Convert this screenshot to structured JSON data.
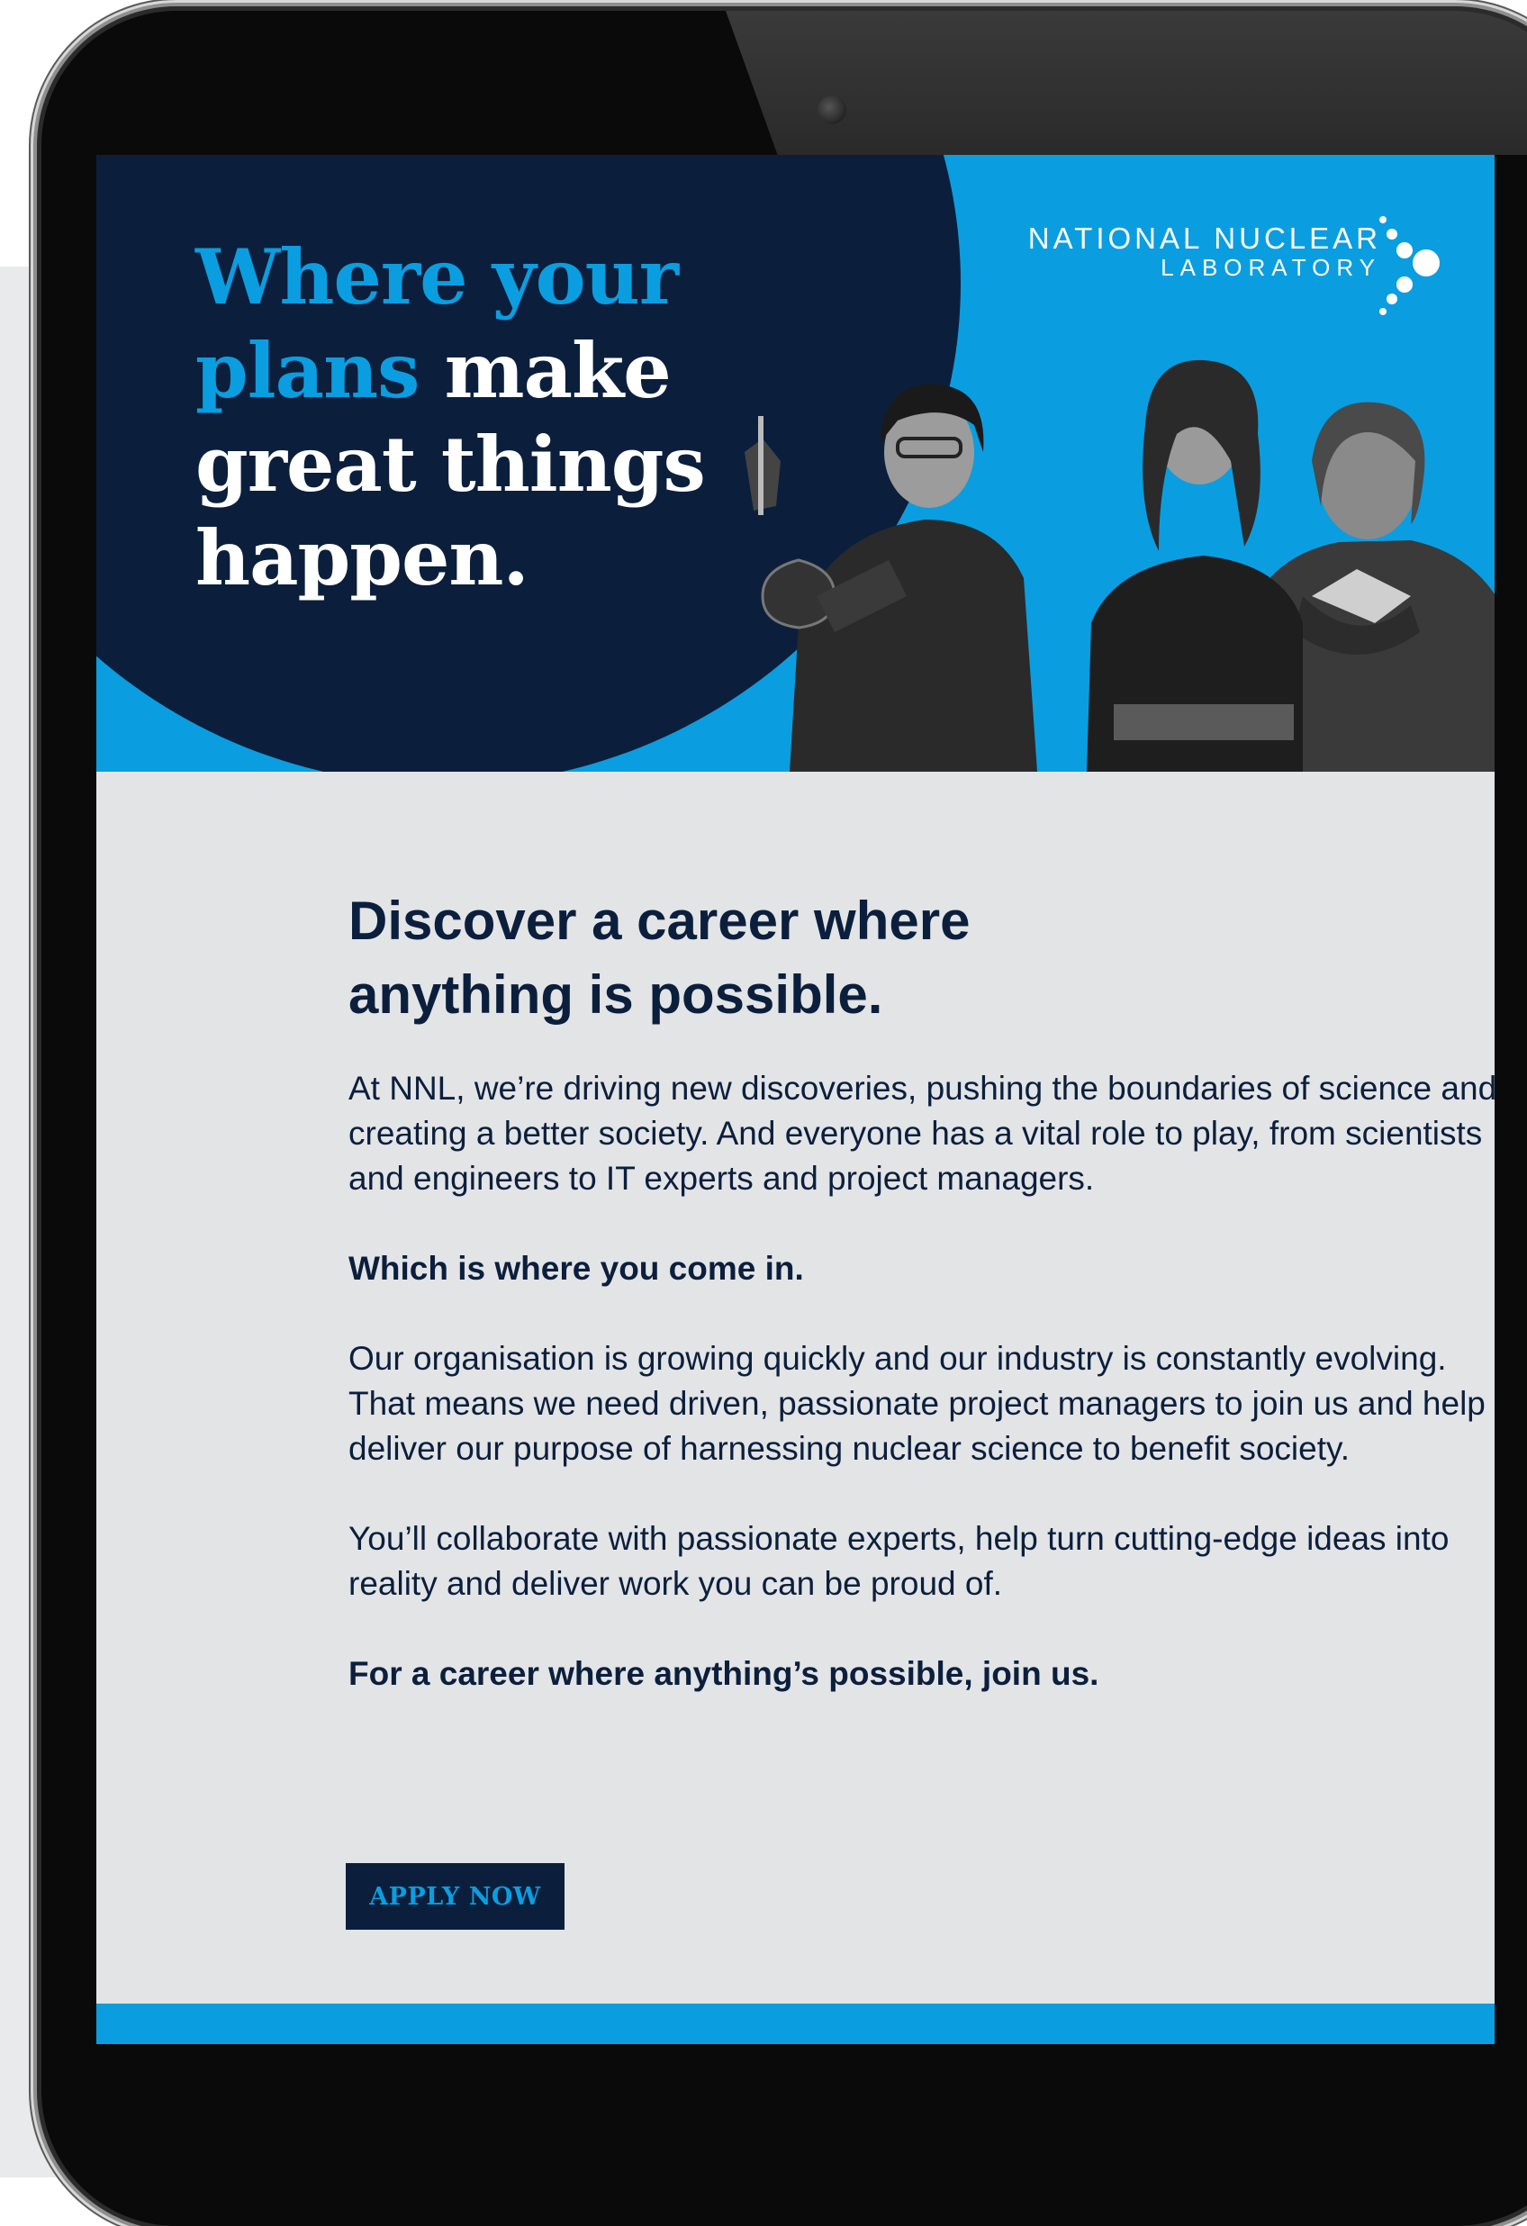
{
  "colors": {
    "navy": "#0b1f3d",
    "brand_blue": "#0a9ee0",
    "content_bg": "#e3e4e6"
  },
  "hero": {
    "headline_line1": "Where your",
    "headline_line2_blue": "plans",
    "headline_line2_white": " make",
    "headline_line3": "great things",
    "headline_line4": "happen."
  },
  "logo": {
    "line1": "NATIONAL NUCLEAR",
    "line2": "LABORATORY"
  },
  "content": {
    "heading_line1": "Discover a career where",
    "heading_line2": "anything is possible.",
    "para1": "At NNL, we’re driving new discoveries, pushing the boundaries of science and creating a better society. And everyone has a vital role to play, from scientists and engineers to IT experts and project managers.",
    "bold1": "Which is where you come in.",
    "para2": "Our organisation is growing quickly and our industry is constantly evolving. That means we need driven, passionate project managers to join us and help deliver our purpose of harnessing nuclear science to benefit society.",
    "para3": "You’ll collaborate with passionate experts, help turn cutting-edge ideas into reality and deliver work you can be proud of.",
    "bold2": "For a career where anything’s possible, join us."
  },
  "cta": {
    "label": "APPLY NOW"
  }
}
